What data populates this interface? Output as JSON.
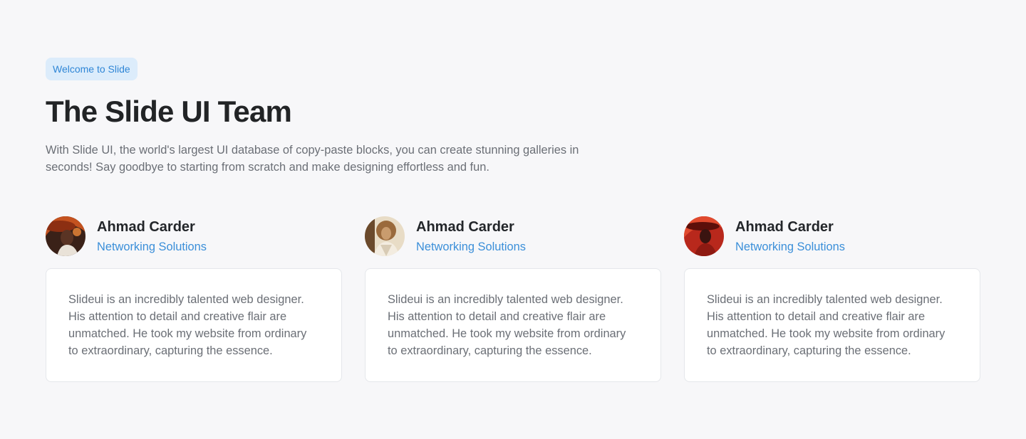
{
  "header": {
    "badge": "Welcome to Slide",
    "title": "The Slide UI Team",
    "description": "With Slide UI, the world's largest UI database of copy-paste blocks, you can create stunning galleries in seconds! Say goodbye to starting from scratch and make designing effortless and fun."
  },
  "team": [
    {
      "name": "Ahmad Carder",
      "role": "Networking Solutions",
      "quote": "Slideui is an incredibly talented web designer. His attention to detail and creative flair are unmatched. He took my website from ordinary to extraordinary, capturing the essence."
    },
    {
      "name": "Ahmad Carder",
      "role": "Networking Solutions",
      "quote": "Slideui is an incredibly talented web designer. His attention to detail and creative flair are unmatched. He took my website from ordinary to extraordinary, capturing the essence."
    },
    {
      "name": "Ahmad Carder",
      "role": "Networking Solutions",
      "quote": "Slideui is an incredibly talented web designer. His attention to detail and creative flair are unmatched. He took my website from ordinary to extraordinary, capturing the essence."
    }
  ],
  "colors": {
    "background": "#f7f7f9",
    "accent": "#3b8fd9",
    "badge_bg": "#dcecfb",
    "text_dark": "#23262a",
    "text_muted": "#6b6f76"
  }
}
